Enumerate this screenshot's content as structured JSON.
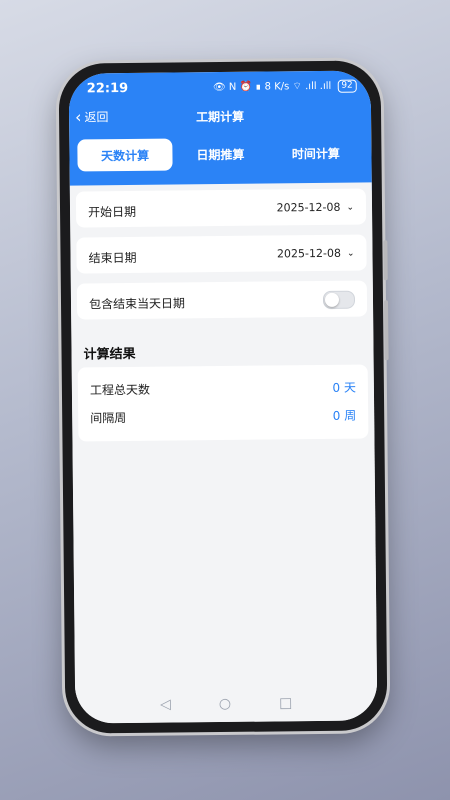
{
  "status_bar": {
    "time": "22:19",
    "icons_text": "👁 N  ⏰ ∎ 8 K/s ⌔ .ıll .ıll",
    "battery": "92"
  },
  "header": {
    "back_label": "返回",
    "title": "工期计算"
  },
  "tabs": [
    {
      "label": "天数计算",
      "active": true
    },
    {
      "label": "日期推算",
      "active": false
    },
    {
      "label": "时间计算",
      "active": false
    }
  ],
  "form": {
    "start_label": "开始日期",
    "start_value": "2025-12-08",
    "end_label": "结束日期",
    "end_value": "2025-12-08",
    "include_end_label": "包含结束当天日期",
    "include_end_on": false
  },
  "results": {
    "section_title": "计算结果",
    "total_days_label": "工程总天数",
    "total_days_value": "0 天",
    "weeks_label": "间隔周",
    "weeks_value": "0 周"
  },
  "nav_icons": {
    "back": "◁",
    "home": "○",
    "recent": "□"
  },
  "colors": {
    "accent": "#2b83f6",
    "background": "#f3f4f6"
  }
}
